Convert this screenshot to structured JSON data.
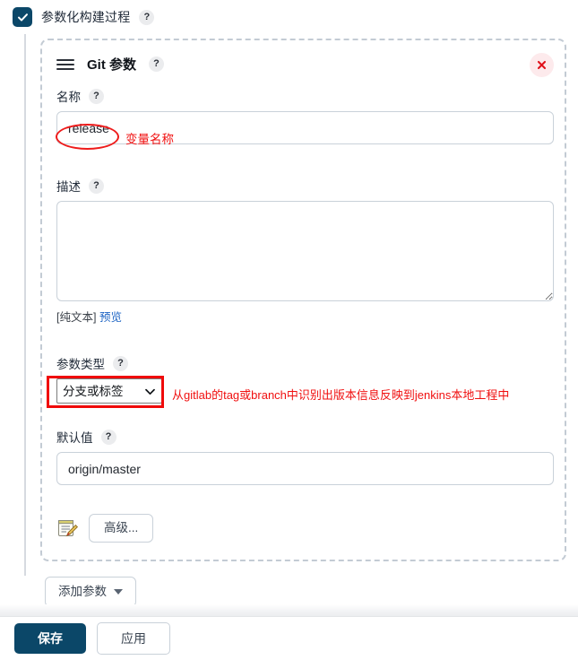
{
  "top": {
    "checkbox_label": "参数化构建过程",
    "checkbox_checked": true,
    "help_glyph": "?"
  },
  "panel": {
    "title": "Git 参数",
    "help_glyph": "?",
    "drag_handle_icon": "drag-handle-icon",
    "close_icon": "close-icon",
    "fields": {
      "name": {
        "label": "名称",
        "help_glyph": "?",
        "value": "release",
        "placeholder": ""
      },
      "description": {
        "label": "描述",
        "help_glyph": "?",
        "value": "",
        "placeholder": "",
        "plain_text_label": "[纯文本]",
        "preview_link": "预览"
      },
      "param_type": {
        "label": "参数类型",
        "help_glyph": "?",
        "selected": "分支或标签",
        "options": [
          "分支或标签"
        ]
      },
      "default_value": {
        "label": "默认值",
        "help_glyph": "?",
        "value": "origin/master",
        "placeholder": ""
      }
    },
    "advanced": {
      "icon": "notepad-pencil-icon",
      "button_label": "高级..."
    }
  },
  "add_param_button": {
    "label": "添加参数",
    "caret_icon": "chevron-down-icon"
  },
  "footer": {
    "save_label": "保存",
    "apply_label": "应用"
  },
  "annotations": {
    "name_note": "变量名称",
    "param_type_note": "从gitlab的tag或branch中识别出版本信息反映到jenkins本地工程中"
  },
  "colors": {
    "accent": "#0b4768",
    "annotation_red": "#f01010",
    "link_blue": "#1d64c4",
    "dashed_border": "#c3cbd4"
  }
}
